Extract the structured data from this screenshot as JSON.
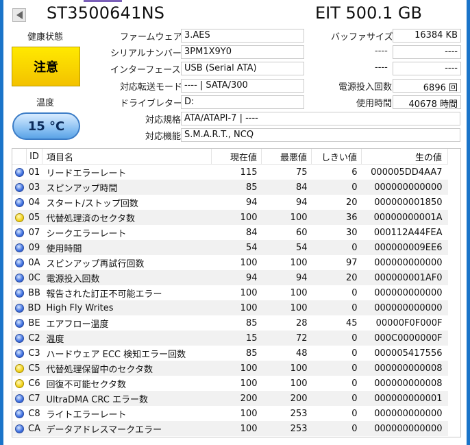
{
  "header": {
    "model": "ST3500641NS",
    "capacity": "EIT 500.1 GB"
  },
  "info": {
    "health_label": "健康状態",
    "health_status": "注意",
    "temperature_label": "温度",
    "temperature_value": "15 °C",
    "firmware_label": "ファームウェア",
    "firmware": "3.AES",
    "serial_label": "シリアルナンバー",
    "serial": "3PM1X9Y0",
    "interface_label": "インターフェース",
    "interface": "USB (Serial ATA)",
    "transfer_label": "対応転送モード",
    "transfer": "---- | SATA/300",
    "drive_letter_label": "ドライブレター",
    "drive_letter": "D:",
    "standard_label": "対応規格",
    "standard": "ATA/ATAPI-7 | ----",
    "features_label": "対応機能",
    "features": "S.M.A.R.T., NCQ",
    "buffer_label": "バッファサイズ",
    "buffer": "16384 KB",
    "blank1_label": "----",
    "blank1": "----",
    "blank2_label": "----",
    "blank2": "----",
    "power_on_count_label": "電源投入回数",
    "power_on_count": "6896 回",
    "power_on_hours_label": "使用時間",
    "power_on_hours": "40678 時間"
  },
  "table": {
    "headers": {
      "id": "ID",
      "name": "項目名",
      "current": "現在値",
      "worst": "最悪値",
      "threshold": "しきい値",
      "raw": "生の値"
    },
    "rows": [
      {
        "status": "good",
        "id": "01",
        "name": "リードエラーレート",
        "current": "115",
        "worst": "75",
        "threshold": "6",
        "raw": "000005DD4AA7"
      },
      {
        "status": "good",
        "id": "03",
        "name": "スピンアップ時間",
        "current": "85",
        "worst": "84",
        "threshold": "0",
        "raw": "000000000000"
      },
      {
        "status": "good",
        "id": "04",
        "name": "スタート/ストップ回数",
        "current": "94",
        "worst": "94",
        "threshold": "20",
        "raw": "000000001850"
      },
      {
        "status": "caution",
        "id": "05",
        "name": "代替処理済のセクタ数",
        "current": "100",
        "worst": "100",
        "threshold": "36",
        "raw": "00000000001A"
      },
      {
        "status": "good",
        "id": "07",
        "name": "シークエラーレート",
        "current": "84",
        "worst": "60",
        "threshold": "30",
        "raw": "000112A44FEA"
      },
      {
        "status": "good",
        "id": "09",
        "name": "使用時間",
        "current": "54",
        "worst": "54",
        "threshold": "0",
        "raw": "000000009EE6"
      },
      {
        "status": "good",
        "id": "0A",
        "name": "スピンアップ再試行回数",
        "current": "100",
        "worst": "100",
        "threshold": "97",
        "raw": "000000000000"
      },
      {
        "status": "good",
        "id": "0C",
        "name": "電源投入回数",
        "current": "94",
        "worst": "94",
        "threshold": "20",
        "raw": "000000001AF0"
      },
      {
        "status": "good",
        "id": "BB",
        "name": "報告された訂正不可能エラー",
        "current": "100",
        "worst": "100",
        "threshold": "0",
        "raw": "000000000000"
      },
      {
        "status": "good",
        "id": "BD",
        "name": "High Fly Writes",
        "current": "100",
        "worst": "100",
        "threshold": "0",
        "raw": "000000000000"
      },
      {
        "status": "good",
        "id": "BE",
        "name": "エアフロー温度",
        "current": "85",
        "worst": "28",
        "threshold": "45",
        "raw": "00000F0F000F"
      },
      {
        "status": "good",
        "id": "C2",
        "name": "温度",
        "current": "15",
        "worst": "72",
        "threshold": "0",
        "raw": "000C0000000F"
      },
      {
        "status": "good",
        "id": "C3",
        "name": "ハードウェア ECC 検知エラー回数",
        "current": "85",
        "worst": "48",
        "threshold": "0",
        "raw": "000005417556"
      },
      {
        "status": "caution",
        "id": "C5",
        "name": "代替処理保留中のセクタ数",
        "current": "100",
        "worst": "100",
        "threshold": "0",
        "raw": "000000000008"
      },
      {
        "status": "caution",
        "id": "C6",
        "name": "回復不可能セクタ数",
        "current": "100",
        "worst": "100",
        "threshold": "0",
        "raw": "000000000008"
      },
      {
        "status": "good",
        "id": "C7",
        "name": "UltraDMA CRC エラー数",
        "current": "200",
        "worst": "200",
        "threshold": "0",
        "raw": "000000000001"
      },
      {
        "status": "good",
        "id": "C8",
        "name": "ライトエラーレート",
        "current": "100",
        "worst": "253",
        "threshold": "0",
        "raw": "000000000000"
      },
      {
        "status": "good",
        "id": "CA",
        "name": "データアドレスマークエラー",
        "current": "100",
        "worst": "253",
        "threshold": "0",
        "raw": "000000000000"
      }
    ]
  }
}
